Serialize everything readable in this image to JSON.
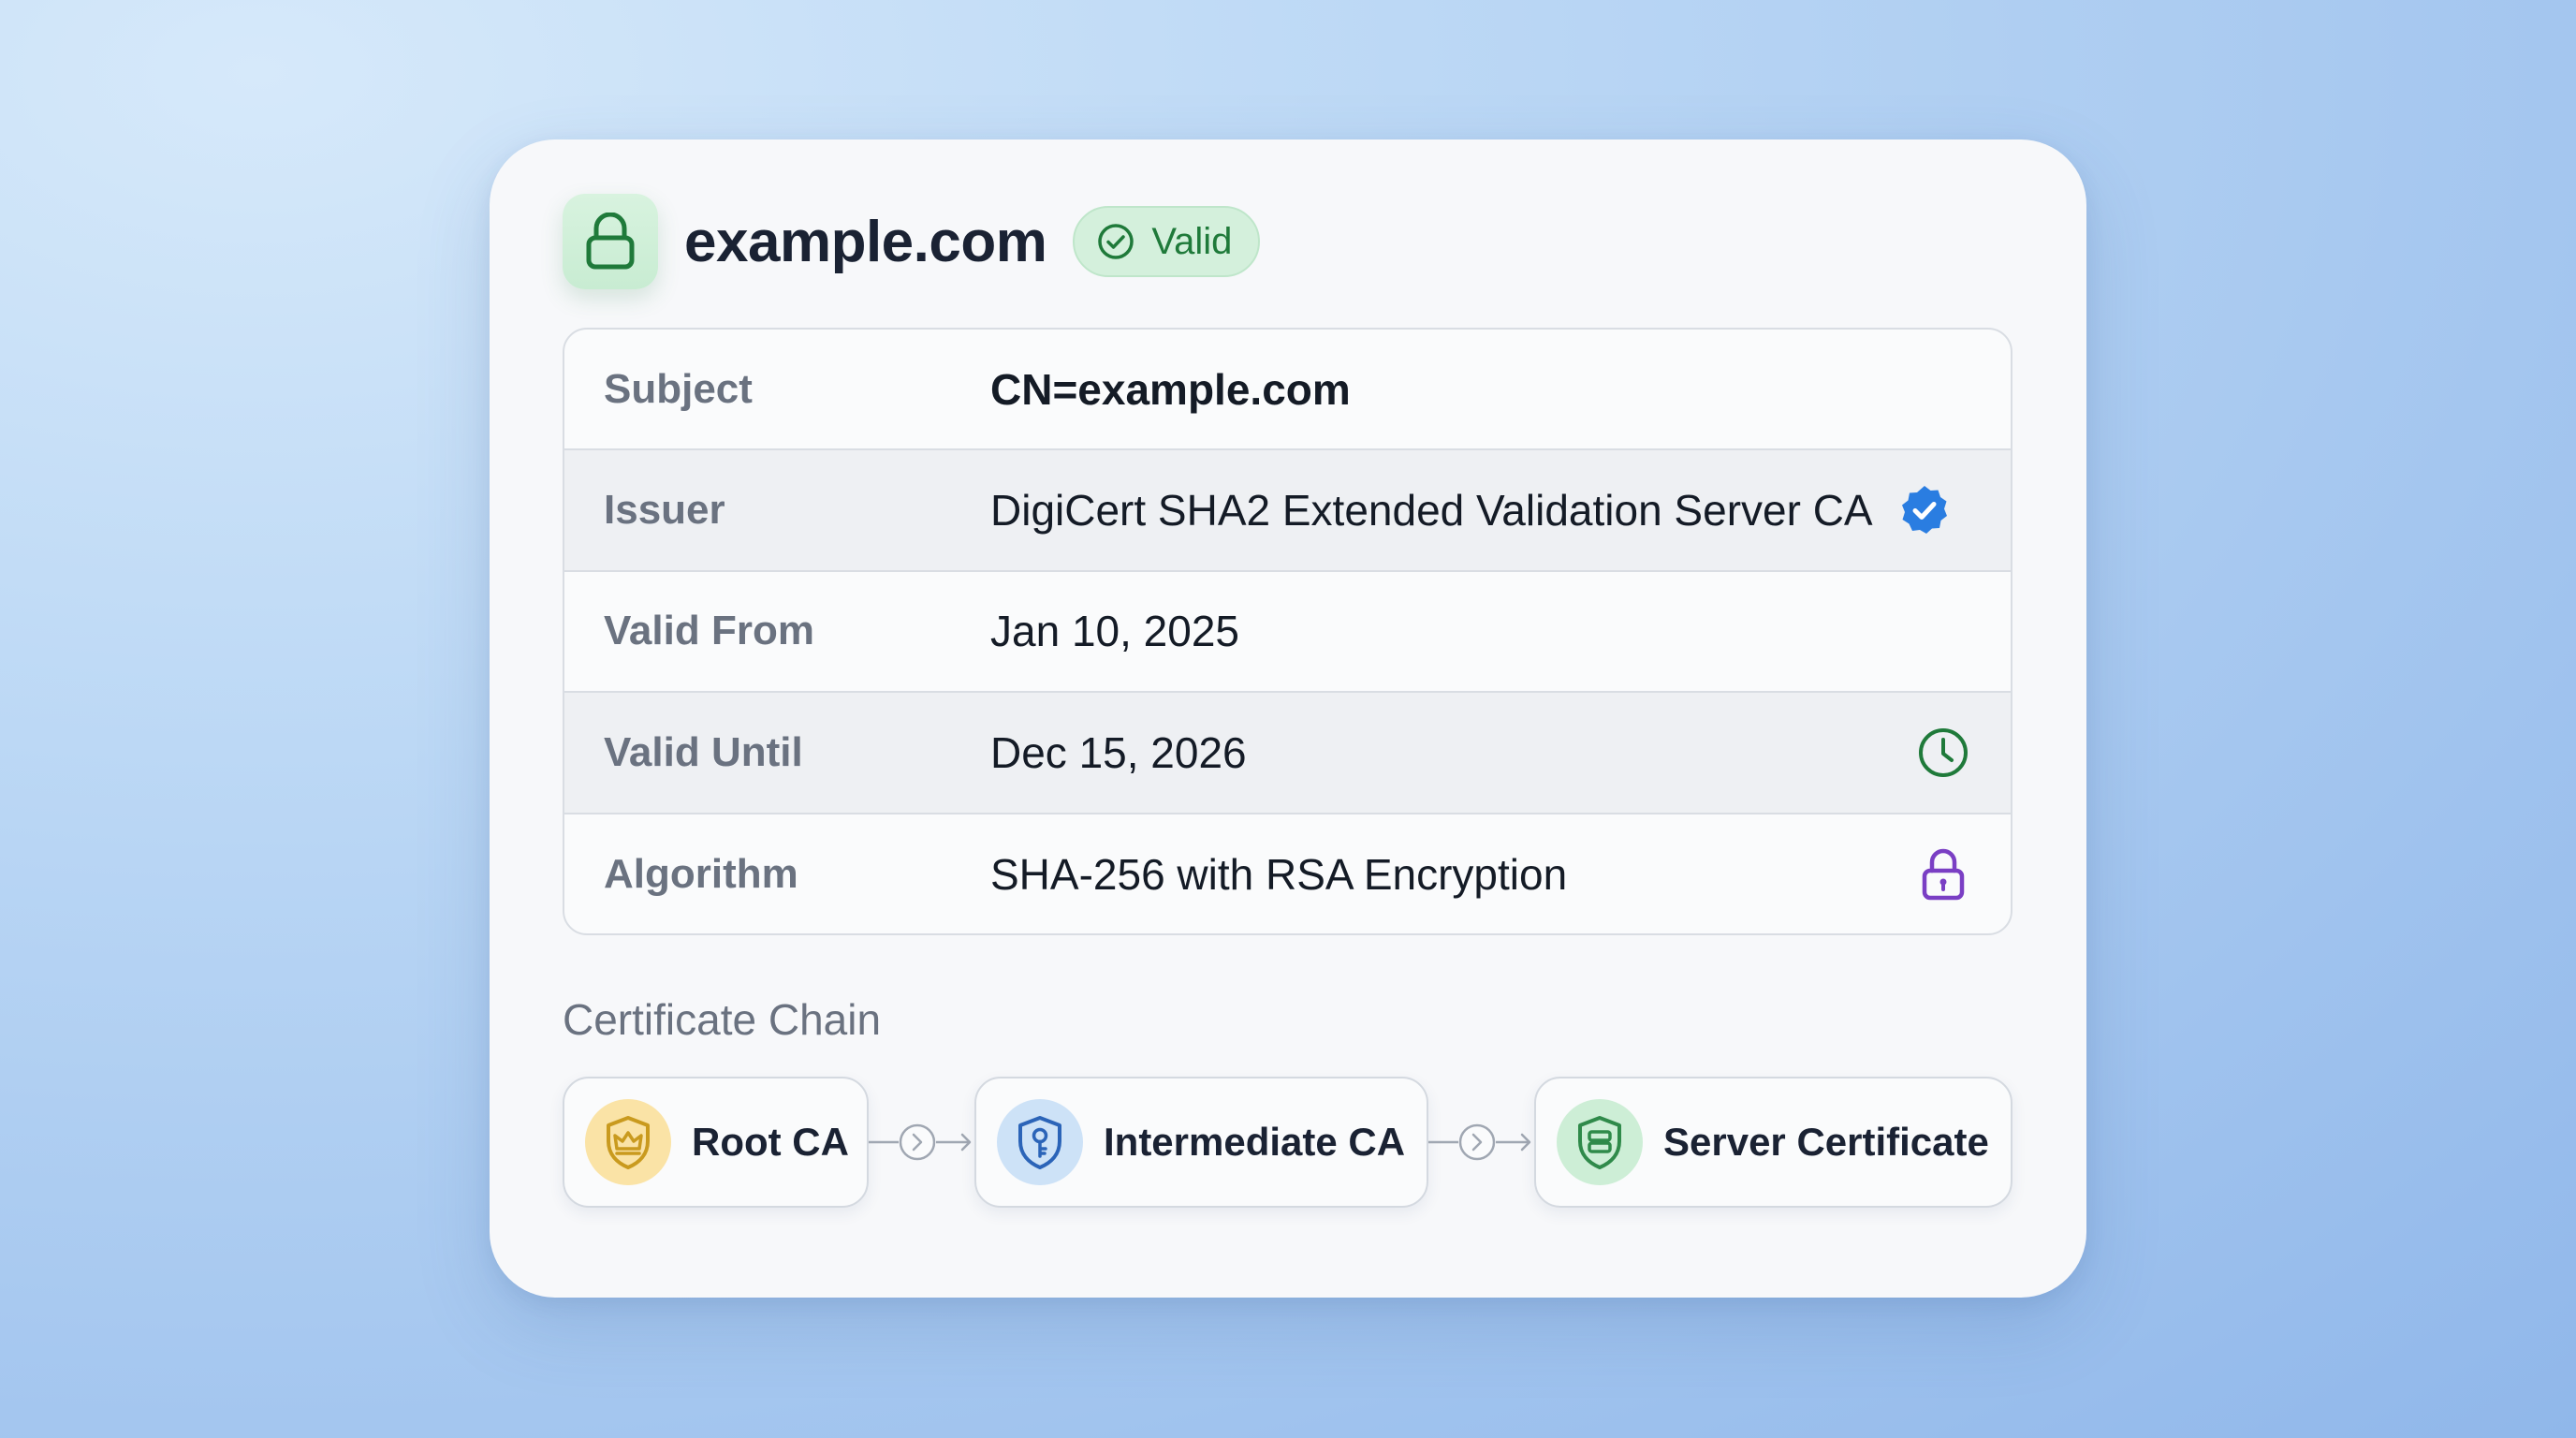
{
  "header": {
    "domain": "example.com",
    "status": "Valid",
    "icons": {
      "tile": "lock-icon",
      "status": "check-circle-icon"
    }
  },
  "details": [
    {
      "label": "Subject",
      "value": "CN=example.com",
      "icon": null
    },
    {
      "label": "Issuer",
      "value": "DigiCert SHA2 Extended Validation Server CA",
      "icon": "verified-badge-icon"
    },
    {
      "label": "Valid From",
      "value": "Jan 10, 2025",
      "icon": null
    },
    {
      "label": "Valid Until",
      "value": "Dec 15, 2026",
      "icon": "clock-icon"
    },
    {
      "label": "Algorithm",
      "value": "SHA-256 with RSA Encryption",
      "icon": "padlock-icon"
    }
  ],
  "chain": {
    "title": "Certificate Chain",
    "nodes": [
      {
        "label": "Root CA",
        "icon": "crown-shield-icon",
        "color": "#d4a017"
      },
      {
        "label": "Intermediate CA",
        "icon": "key-shield-icon",
        "color": "#2b64b8"
      },
      {
        "label": "Server Certificate",
        "icon": "server-shield-icon",
        "color": "#2f8a4a"
      }
    ]
  },
  "colors": {
    "green": "#1f7a3a",
    "blue": "#2a7de1",
    "purple": "#7a3fc4",
    "gold": "#c99a1e"
  }
}
